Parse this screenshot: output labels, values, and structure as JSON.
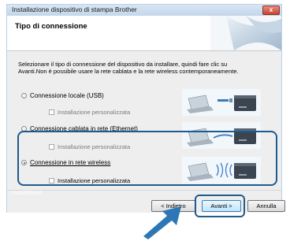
{
  "window": {
    "title": "Installazione dispositivo di stampa Brother",
    "close_label": "x"
  },
  "header": {
    "heading": "Tipo di connessione"
  },
  "instructions": {
    "line1": "Selezionare il tipo di connessione del dispositivo da installare, quindi fare clic su",
    "line2": "Avanti.Non è possibile usare la rete cablata e la rete wireless contemporaneamente."
  },
  "options": [
    {
      "label": "Connessione locale (USB)",
      "selected": false,
      "sub_label": "Installazione personalizzata",
      "sub_enabled": false,
      "image": "usb-connection-illustration"
    },
    {
      "label": "Connessione cablata in rete (Ethernet)",
      "selected": false,
      "sub_label": "Installazione personalizzata",
      "sub_enabled": false,
      "image": "ethernet-connection-illustration"
    },
    {
      "label": "Connessione in rete wireless",
      "selected": true,
      "sub_label": "Installazione personalizzata",
      "sub_enabled": true,
      "image": "wireless-connection-illustration"
    }
  ],
  "footer": {
    "brand_label": "InstallShield",
    "back_label": "< Indietro",
    "next_label": "Avanti >",
    "cancel_label": "Annulla"
  },
  "colors": {
    "highlight": "#1f5b8e",
    "arrow": "#2e77b6"
  }
}
